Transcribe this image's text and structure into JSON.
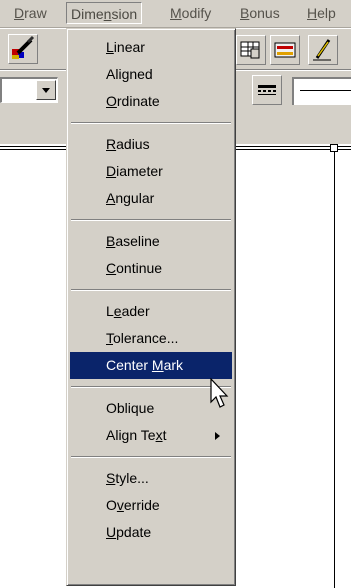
{
  "menubar": {
    "items": [
      {
        "label": "Draw",
        "mnemonic": "D"
      },
      {
        "label": "Dimension",
        "mnemonic": "n"
      },
      {
        "label": "Modify",
        "mnemonic": "M"
      },
      {
        "label": "Bonus",
        "mnemonic": "B"
      },
      {
        "label": "Help",
        "mnemonic": "H"
      }
    ],
    "active": "Dimension"
  },
  "dimension_menu": {
    "groups": [
      [
        {
          "label": "Linear",
          "mnemonic": "L"
        },
        {
          "label": "Aligned",
          "mnemonic": "g"
        },
        {
          "label": "Ordinate",
          "mnemonic": "O"
        }
      ],
      [
        {
          "label": "Radius",
          "mnemonic": "R"
        },
        {
          "label": "Diameter",
          "mnemonic": "D"
        },
        {
          "label": "Angular",
          "mnemonic": "A"
        }
      ],
      [
        {
          "label": "Baseline",
          "mnemonic": "B"
        },
        {
          "label": "Continue",
          "mnemonic": "C"
        }
      ],
      [
        {
          "label": "Leader",
          "mnemonic": "e"
        },
        {
          "label": "Tolerance...",
          "mnemonic": "T"
        },
        {
          "label": "Center Mark",
          "mnemonic": "M",
          "highlighted": true
        }
      ],
      [
        {
          "label": "Oblique",
          "mnemonic": "Q"
        },
        {
          "label": "Align Text",
          "mnemonic": "x",
          "submenu": true
        }
      ],
      [
        {
          "label": "Style...",
          "mnemonic": "S"
        },
        {
          "label": "Override",
          "mnemonic": "v"
        },
        {
          "label": "Update",
          "mnemonic": "U"
        }
      ]
    ]
  },
  "colors": {
    "menu_bg": "#d4d0c8",
    "highlight_bg": "#0a246a",
    "highlight_text": "#ffffff",
    "disabled_text": "#55524b"
  },
  "icons": [
    "paintbrush-icon",
    "table-icon",
    "layer-icon",
    "pencil-icon",
    "linetype-icon",
    "cursor-arrow-icon"
  ]
}
